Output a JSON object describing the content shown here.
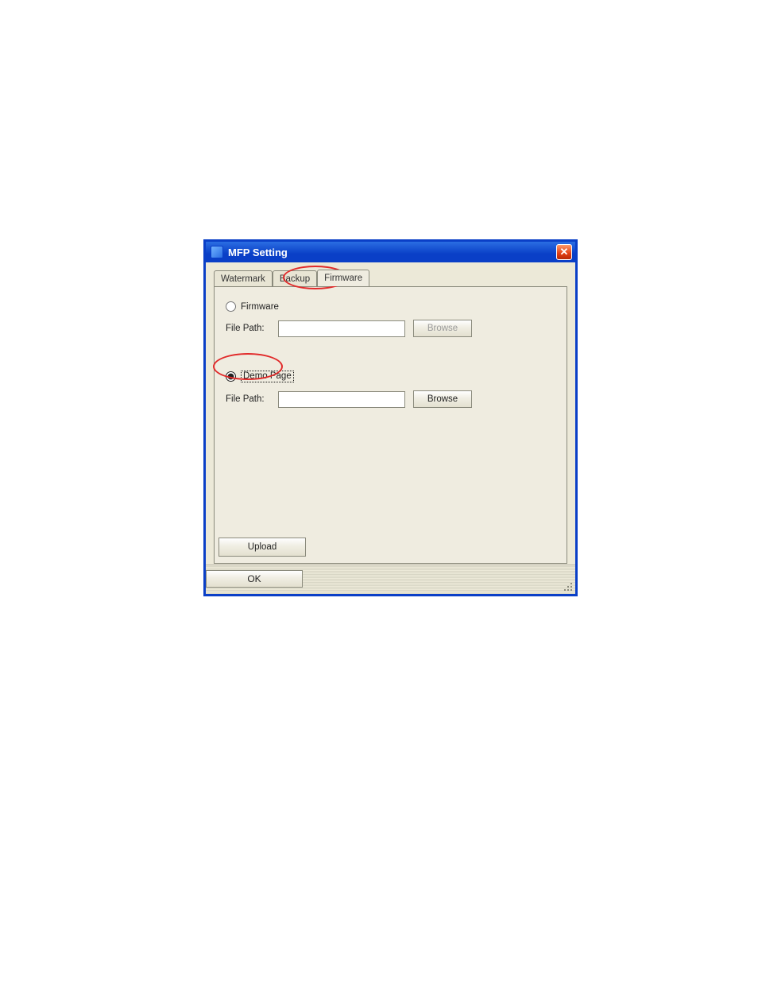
{
  "window": {
    "title": "MFP Setting"
  },
  "tabs": {
    "watermark": "Watermark",
    "backup": "Backup",
    "firmware": "Firmware"
  },
  "firmware_section": {
    "radio_label": "Firmware",
    "file_path_label": "File Path:",
    "file_path_value": "",
    "browse_label": "Browse"
  },
  "demopage_section": {
    "radio_label": "Demo Page",
    "file_path_label": "File Path:",
    "file_path_value": "",
    "browse_label": "Browse"
  },
  "actions": {
    "upload": "Upload",
    "ok": "OK"
  },
  "selected_option": "demo_page",
  "annotations": {
    "ring_on_tab": "firmware",
    "ring_on_radio": "demo_page"
  }
}
